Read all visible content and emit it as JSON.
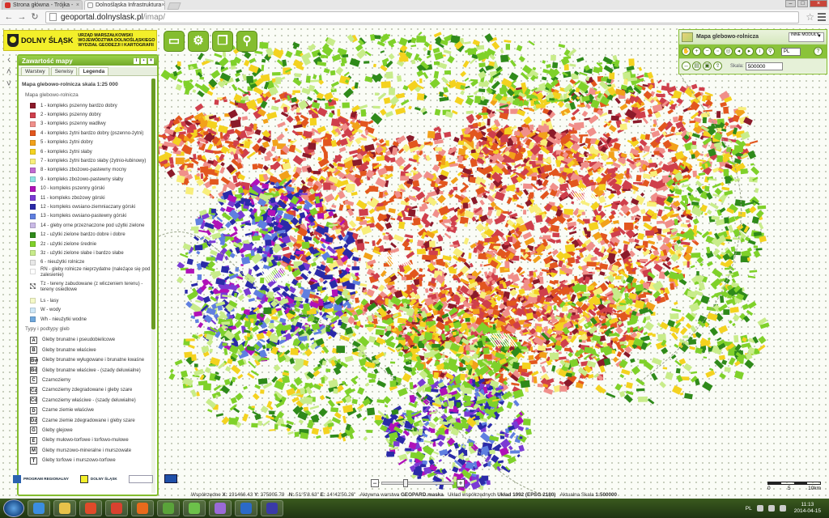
{
  "browser": {
    "tabs": [
      {
        "title": "Strona główna - Trójka -",
        "favicon_color": "#d6312a"
      },
      {
        "title": "Dolnośląska Infrastruktura",
        "favicon_color": "#ffffff"
      }
    ],
    "url_domain": "geoportal.dolnyslask.pl",
    "url_path": "/imap/"
  },
  "header": {
    "logo_name": "DOLNY ŚLĄSK",
    "org_line1": "URZĄD MARSZAŁKOWSKI",
    "org_line2": "WOJEWÓDZTWA DOLNOŚLĄSKIEGO",
    "org_line3": "WYDZIAŁ GEODEZJI I KARTOGRAFII"
  },
  "toolbar_icons": [
    "folder-icon",
    "settings-icon",
    "windows-icon",
    "search-icon"
  ],
  "panel": {
    "title": "Zawartość mapy",
    "tabs": [
      "Warstwy",
      "Serwisy",
      "Legenda"
    ],
    "active_tab": "Legenda",
    "legend_title": "Mapa glebowo-rolnicza skala 1:25 000",
    "section1": "Mapa glebowo-rolnicza",
    "items": [
      {
        "label": "1 - kompleks pszenny bardzo dobry",
        "color": "#8b1a2a"
      },
      {
        "label": "2 - kompleks pszenny dobry",
        "color": "#cf3f4c"
      },
      {
        "label": "3 - kompleks pszenny wadliwy",
        "color": "#f08f8a"
      },
      {
        "label": "4 - kompleks żytni bardzo dobry (pszenno-żytni)",
        "color": "#e2561e"
      },
      {
        "label": "5 - kompleks żytni dobry",
        "color": "#f2a11a"
      },
      {
        "label": "6 - kompleks żytni słaby",
        "color": "#f4d21f"
      },
      {
        "label": "7 - kompleks żytni bardzo słaby (żytnio-łubinowy)",
        "color": "#f8ee7a"
      },
      {
        "label": "8 - kompleks zbożowo-pastewny mocny",
        "color": "#c06ad0"
      },
      {
        "label": "9 - kompleks zbożowo-pastewny słaby",
        "color": "#8fe3e3"
      },
      {
        "label": "10 - kompleks pszenny górski",
        "color": "#b011b8"
      },
      {
        "label": "11 - kompleks zbożowy górski",
        "color": "#7a3bd4"
      },
      {
        "label": "12 - kompleks owsiano-ziemniaczany górski",
        "color": "#2a2aa8"
      },
      {
        "label": "13 - kompleks owsiano-pastewny górski",
        "color": "#5f7fe0"
      },
      {
        "label": "14 - gleby orne przeznaczone pod użytki zielone",
        "color": "#c9b9e6"
      },
      {
        "label": "1z - użytki zielone bardzo dobre i dobre",
        "color": "#2f8a1a"
      },
      {
        "label": "2z - użytki zielone średnie",
        "color": "#7fd12a"
      },
      {
        "label": "3z - użytki zielone słabe i bardzo słabe",
        "color": "#c8ec8a"
      },
      {
        "label": "6 - nieużytki rolnicze",
        "color": "#e8e8e8"
      }
    ],
    "items_extra": [
      {
        "label": "RN - gleby rolnicze nieprzydatne (należące się pod zalesienie)",
        "swatch": "#ffffff"
      },
      {
        "label": "Tz - tereny zabudowane (z wliczeniem terenu) - tereny osiedlowe",
        "swatch": "hatch"
      },
      {
        "label": "Ls - lasy",
        "swatch": "#f5f9c8"
      },
      {
        "label": "W - wody",
        "swatch": "#cfe8f8"
      },
      {
        "label": "Wh - nieużytki wodne",
        "swatch": "#6fa8dc"
      }
    ],
    "section2": "Typy i podtypy gleb",
    "soil_types": [
      {
        "code": "A",
        "label": "Gleby brunatne i pseudobielicowe"
      },
      {
        "code": "B",
        "label": "Gleby brunatne właściwe"
      },
      {
        "code": "Bw",
        "label": "Gleby brunatne wyługowane i brunatne kwaśne"
      },
      {
        "code": "Bd",
        "label": "Gleby brunatne właściwe - (szady deluwialne)"
      },
      {
        "code": "C",
        "label": "Czarnoziemy"
      },
      {
        "code": "Cz",
        "label": "Czarnoziemy zdegradowane i gleby szare"
      },
      {
        "code": "Cd",
        "label": "Czarnoziemy właściwe - (szady deluwialne)"
      },
      {
        "code": "D",
        "label": "Czarne ziemie właściwe"
      },
      {
        "code": "Dz",
        "label": "Czarne ziemie zdegradowane i gleby szare"
      },
      {
        "code": "G",
        "label": "Gleby glejowe"
      },
      {
        "code": "E",
        "label": "Gleby mułowo-torfowe i torfowo-mułowe"
      },
      {
        "code": "M",
        "label": "Gleby murszowo-mineralne i murszowate"
      },
      {
        "code": "T",
        "label": "Gleby torfowe i murszowo-torfowe"
      }
    ]
  },
  "right_panel": {
    "map_title": "Mapa glebowo-rolnicza",
    "modules_label": "INNE MODUŁY",
    "language": "PL",
    "scale_label": "Skala:",
    "scale_value": "500000"
  },
  "status": {
    "coord_label": "Współrzędne",
    "x_label": "X:",
    "x_value": "191466.43",
    "y_label": "Y:",
    "y_value": "375905.79",
    "n_label": "N:",
    "n_value": "51°5'8.63\"",
    "e_label": "E:",
    "e_value": "14°42'50.26\"",
    "active_label": "Aktywna warstwa",
    "active_value": "GEOPARD.maska",
    "crs_label": "Układ współrzędnych",
    "crs_value": "Układ 1992 (EPSG 2180)",
    "scale_label": "Aktualna Skala",
    "scale_value": "1:500000"
  },
  "scalebar": {
    "labels": [
      "0",
      "5",
      "10km"
    ]
  },
  "logos": {
    "program": "PROGRAM REGIONALNY",
    "ds": "DOLNY ŚLĄSK",
    "eu_color": "#1f4fa8"
  },
  "taskbar": {
    "apps": [
      {
        "icon": "ie-icon",
        "color": "#3b8de0"
      },
      {
        "icon": "explorer-icon",
        "color": "#e8c24a"
      },
      {
        "icon": "media-icon",
        "color": "#e04a2a"
      },
      {
        "icon": "chrome-icon",
        "color": "#d9412f"
      },
      {
        "icon": "firefox-icon",
        "color": "#e86a1c"
      },
      {
        "icon": "qgis-icon",
        "color": "#5aa33a"
      },
      {
        "icon": "evernote-icon",
        "color": "#6cc14a"
      },
      {
        "icon": "gallery-icon",
        "color": "#9a6ad8"
      },
      {
        "icon": "outlook-icon",
        "color": "#2b6ac8"
      },
      {
        "icon": "save-icon",
        "color": "#3a3aa8"
      }
    ],
    "lang": "PL",
    "time": "11:13",
    "date": "2014-04-15"
  }
}
